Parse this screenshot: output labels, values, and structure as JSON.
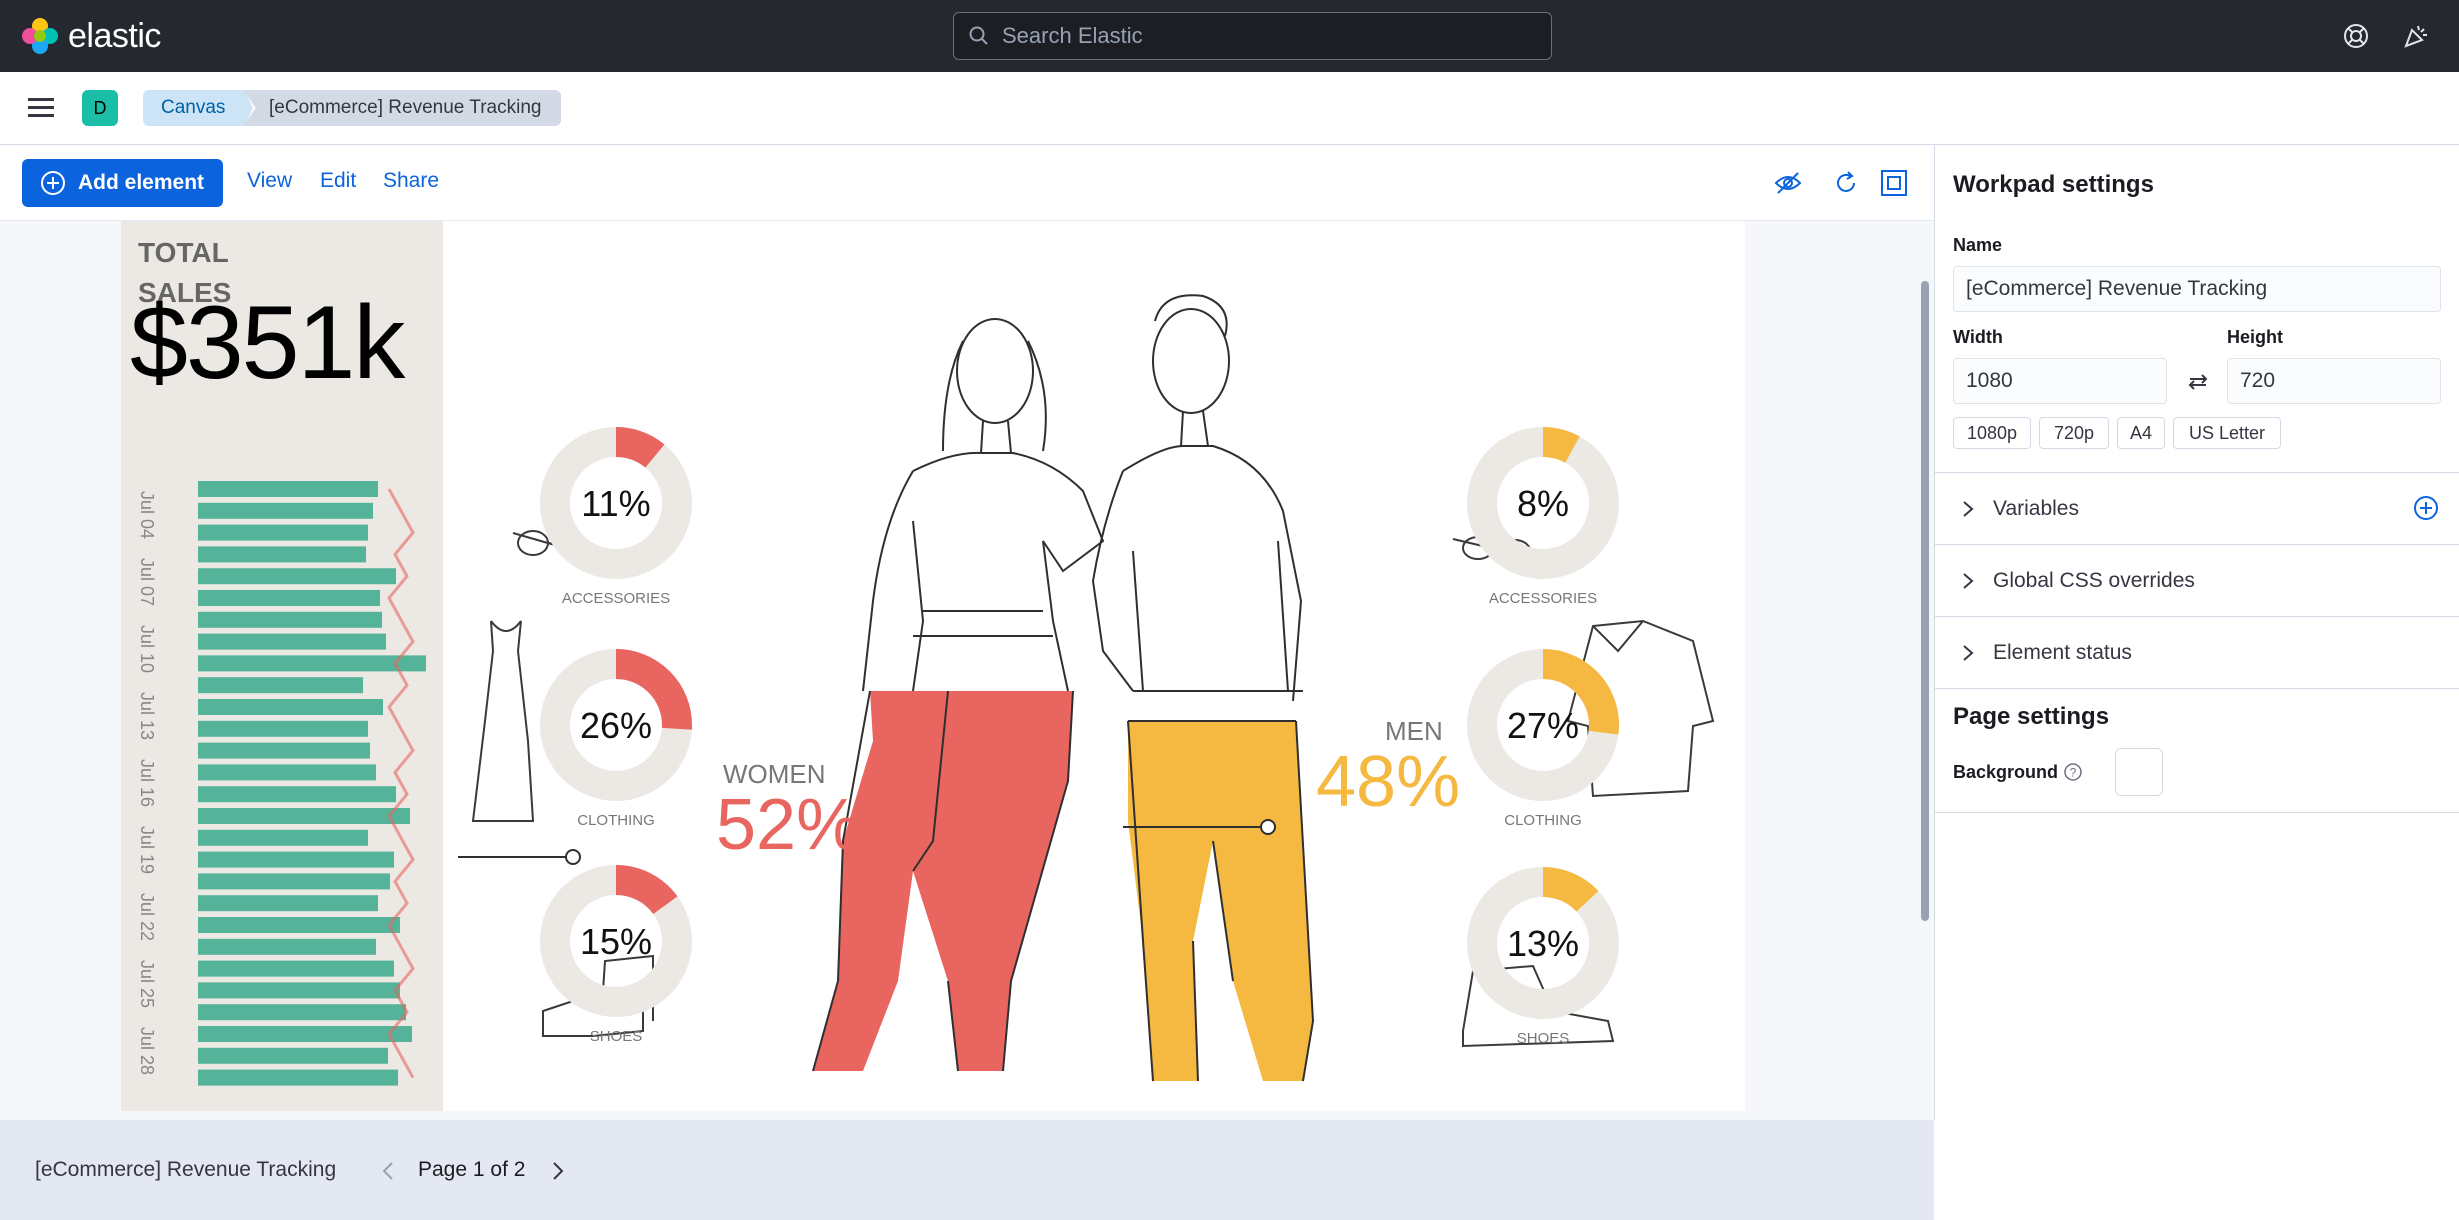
{
  "header": {
    "brand": "elastic",
    "search_placeholder": "Search Elastic"
  },
  "nav": {
    "space_initial": "D",
    "breadcrumbs": [
      "Canvas",
      "[eCommerce] Revenue Tracking"
    ]
  },
  "toolbar": {
    "add_label": "Add element",
    "links": [
      "View",
      "Edit",
      "Share"
    ]
  },
  "workpad": {
    "total_label": "TOTAL SALES",
    "total_value": "$351k",
    "dates": [
      "Jul 04",
      "Jul 07",
      "Jul 10",
      "Jul 13",
      "Jul 16",
      "Jul 19",
      "Jul 22",
      "Jul 25",
      "Jul 28"
    ],
    "women_label": "WOMEN",
    "women_pct": "52%",
    "men_label": "MEN",
    "men_pct": "48%",
    "women_donuts": [
      {
        "pct": "11%",
        "value": 0.11,
        "label": "ACCESSORIES"
      },
      {
        "pct": "26%",
        "value": 0.26,
        "label": "CLOTHING"
      },
      {
        "pct": "15%",
        "value": 0.15,
        "label": "SHOES"
      }
    ],
    "men_donuts": [
      {
        "pct": "8%",
        "value": 0.08,
        "label": "ACCESSORIES"
      },
      {
        "pct": "27%",
        "value": 0.27,
        "label": "CLOTHING"
      },
      {
        "pct": "13%",
        "value": 0.13,
        "label": "SHOES"
      }
    ],
    "colors": {
      "women": "#e8665f",
      "men": "#f5b841",
      "bars": "#54b399",
      "trend": "#e8665f",
      "donut_track": "#ece9e4"
    }
  },
  "settings": {
    "title": "Workpad settings",
    "name_label": "Name",
    "name_value": "[eCommerce] Revenue Tracking",
    "width_label": "Width",
    "width_value": "1080",
    "height_label": "Height",
    "height_value": "720",
    "presets": [
      "1080p",
      "720p",
      "A4",
      "US Letter"
    ],
    "sections": [
      "Variables",
      "Global CSS overrides",
      "Element status"
    ],
    "page_settings_title": "Page settings",
    "background_label": "Background"
  },
  "footer": {
    "title": "[eCommerce] Revenue Tracking",
    "page_indicator": "Page 1 of 2"
  }
}
